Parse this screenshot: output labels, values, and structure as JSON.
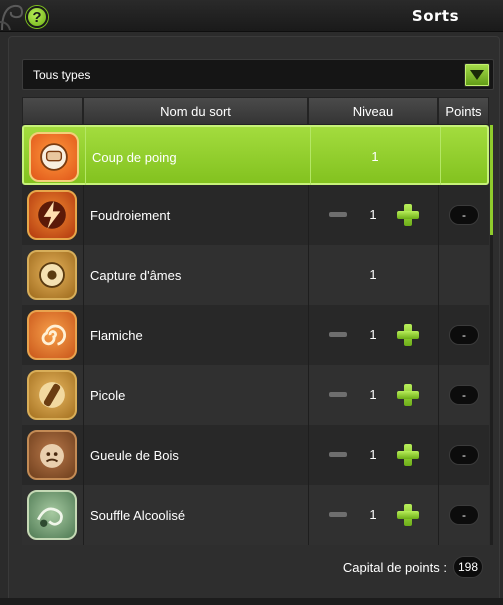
{
  "window": {
    "title": "Sorts",
    "help_label": "?"
  },
  "filter": {
    "selected": "Tous types"
  },
  "table": {
    "headers": {
      "name": "Nom du sort",
      "level": "Niveau",
      "points": "Points"
    },
    "rows": [
      {
        "name": "Coup de poing",
        "level": "1",
        "icon": "fist-icon",
        "selected": true,
        "editable": false,
        "points": ""
      },
      {
        "name": "Foudroiement",
        "level": "1",
        "icon": "lightning-icon",
        "selected": false,
        "editable": true,
        "points": "-"
      },
      {
        "name": "Capture d'âmes",
        "level": "1",
        "icon": "soul-capture-icon",
        "selected": false,
        "editable": false,
        "points": ""
      },
      {
        "name": "Flamiche",
        "level": "1",
        "icon": "spiral-flame-icon",
        "selected": false,
        "editable": true,
        "points": "-"
      },
      {
        "name": "Picole",
        "level": "1",
        "icon": "bottle-icon",
        "selected": false,
        "editable": true,
        "points": "-"
      },
      {
        "name": "Gueule de Bois",
        "level": "1",
        "icon": "hangover-face-icon",
        "selected": false,
        "editable": true,
        "points": "-"
      },
      {
        "name": "Souffle Alcoolisé",
        "level": "1",
        "icon": "breath-icon",
        "selected": false,
        "editable": true,
        "points": "-"
      }
    ]
  },
  "capital": {
    "label": "Capital de points :",
    "value": "198"
  },
  "colors": {
    "accent_green": "#8cc63f",
    "background": "#2b2b2b"
  }
}
